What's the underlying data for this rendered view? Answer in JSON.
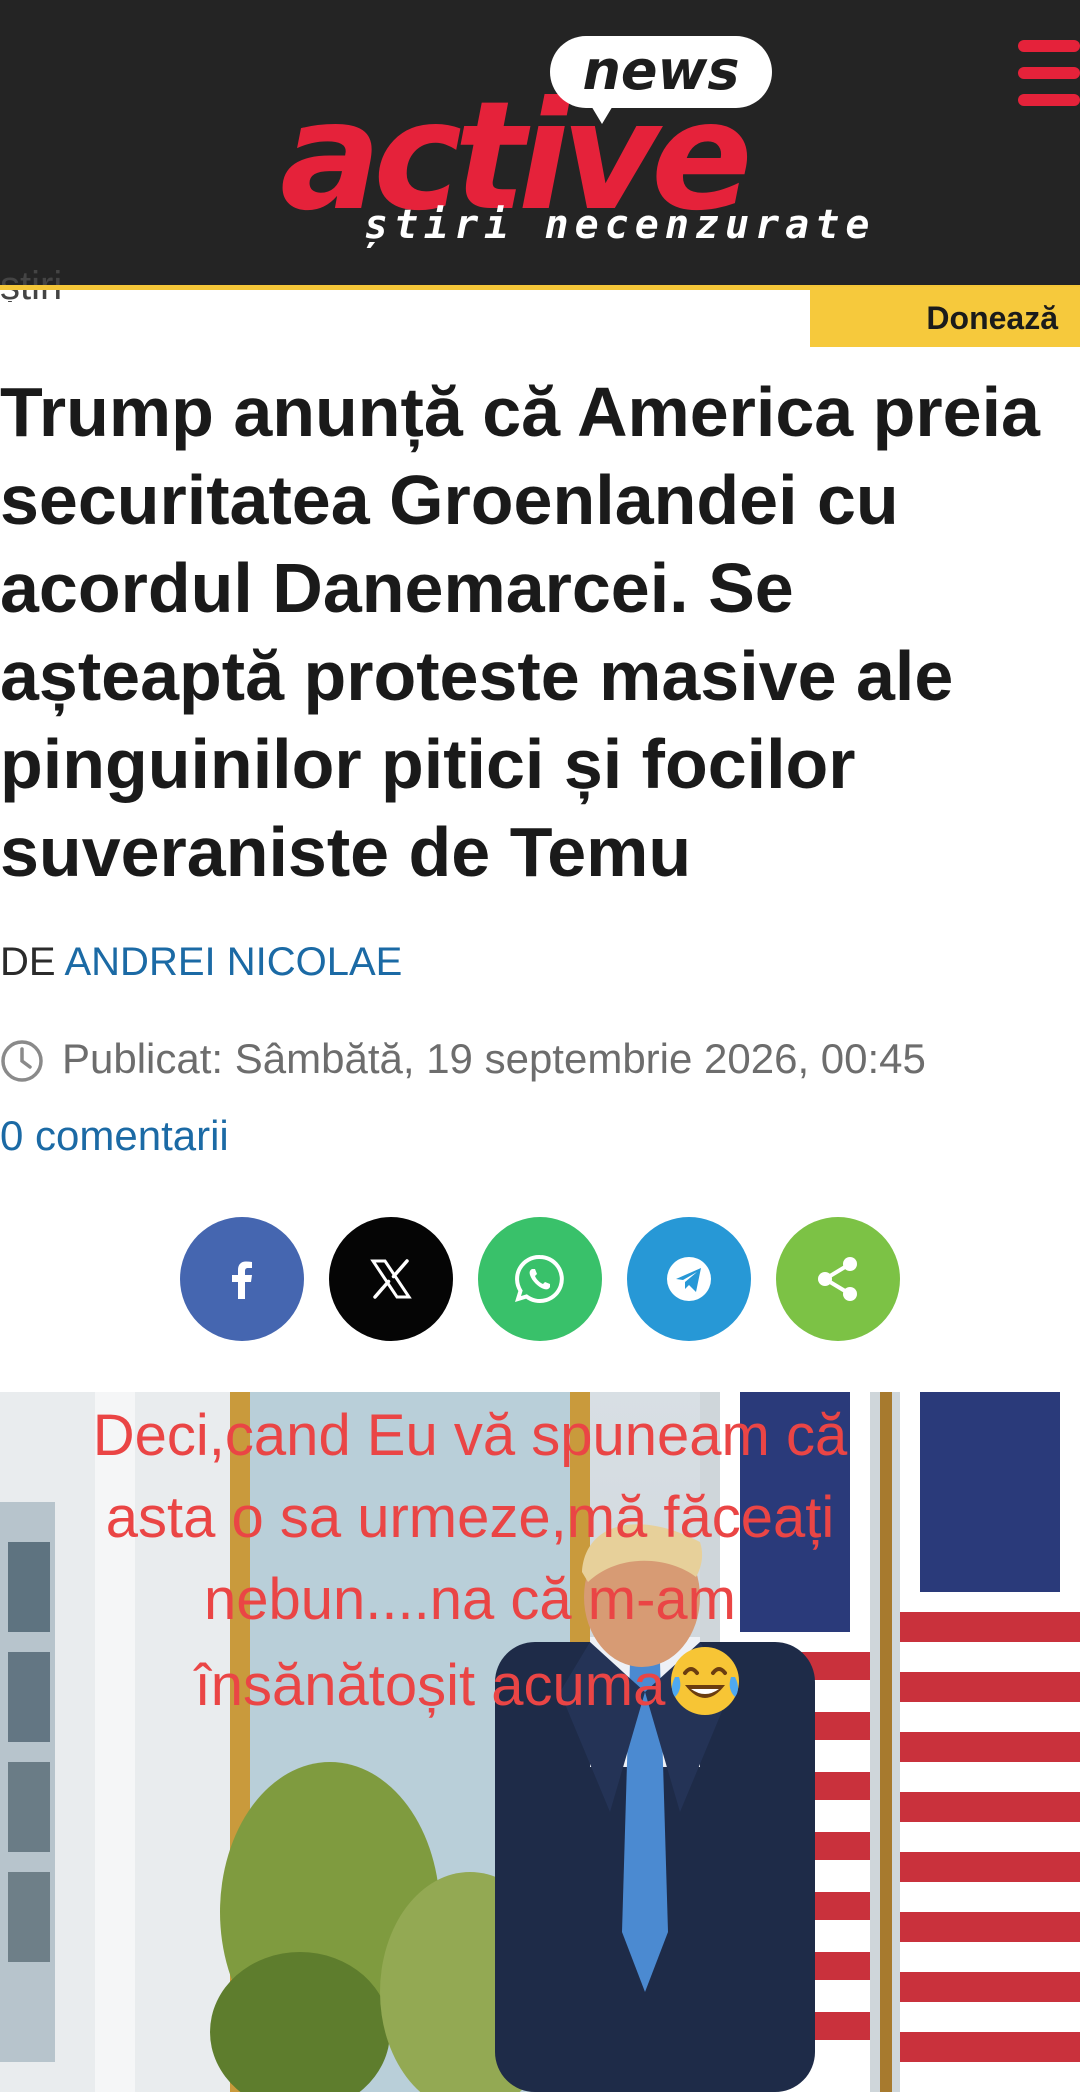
{
  "header": {
    "logo_bubble": "news",
    "logo_main": "active",
    "logo_tagline": "știri necenzurate",
    "menu_icon": "hamburger-menu-icon",
    "colors": {
      "background": "#242424",
      "brand_red": "#e5223a",
      "accent_gold": "#f4c638"
    }
  },
  "breadcrumb": "știri",
  "donate_label": "Donează",
  "article": {
    "title": "Trump anunță că America preia securitatea Groenlandei cu acordul Danemarcei. Se așteaptă proteste masive ale pinguinilor pitici și focilor suveraniste de Temu",
    "by_prefix": "DE",
    "author": "ANDREI NICOLAE",
    "published": "Publicat: Sâmbătă, 19 septembrie 2026, 00:45",
    "comments": "0 comentarii",
    "link_color": "#1b6aa5"
  },
  "share_buttons": [
    {
      "icon": "facebook-icon",
      "color": "#4566b0"
    },
    {
      "icon": "x-icon",
      "color": "#050505"
    },
    {
      "icon": "whatsapp-icon",
      "color": "#39c16a"
    },
    {
      "icon": "telegram-icon",
      "color": "#2798d6"
    },
    {
      "icon": "share-icon",
      "color": "#7cc245"
    }
  ],
  "photo_caption_overlay": {
    "lines": [
      "Deci,cand  Eu vă spuneam că",
      "asta o sa urmeze,mă făceați",
      "nebun....na că m-am",
      "însănătoșit acuma"
    ],
    "emoji": "face-with-tears-of-joy-icon",
    "color": "#ea4545"
  }
}
